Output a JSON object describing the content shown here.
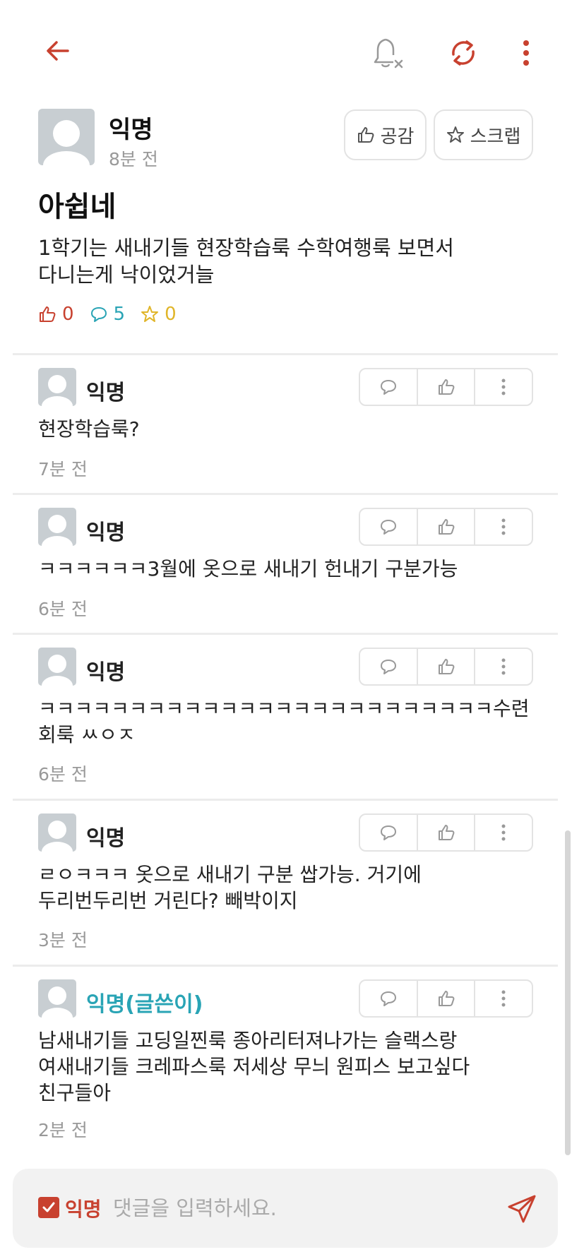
{
  "icons": {
    "back": "back-arrow-icon",
    "notifications": "bell-off-icon",
    "refresh": "refresh-icon",
    "more": "more-vertical-icon"
  },
  "colors": {
    "accent": "#c8412f",
    "comment_count": "#29a4b5",
    "scrap_count": "#e0b529",
    "op_author": "#29a4b5",
    "muted": "#999999"
  },
  "post": {
    "author": "익명",
    "time": "8분 전",
    "like_button": "공감",
    "scrap_button": "스크랩",
    "title": "아쉽네",
    "body": "1학기는 새내기들 현장학습룩 수학여행룩 보면서\n다니는게 낙이었거늘",
    "stats": {
      "likes": "0",
      "comments": "5",
      "scraps": "0"
    }
  },
  "comments": [
    {
      "author": "익명",
      "text": "현장학습룩?",
      "time": "7분 전"
    },
    {
      "author": "익명",
      "text": "ㅋㅋㅋㅋㅋㅋ3월에 옷으로 새내기 헌내기 구분가능",
      "time": "6분 전"
    },
    {
      "author": "익명",
      "text": "ㅋㅋㅋㅋㅋㅋㅋㅋㅋㅋㅋㅋㅋㅋㅋㅋㅋㅋㅋㅋㅋㅋㅋㅋㅋ수련\n회룩 ㅆㅇㅈ",
      "time": "6분 전"
    },
    {
      "author": "익명",
      "text": "ㄹㅇㅋㅋㅋ 옷으로 새내기 구분 쌉가능. 거기에\n두리번두리번 거린다? 빼박이지",
      "time": "3분 전"
    },
    {
      "author": "익명(글쓴이)",
      "text": "남새내기들 고딩일찐룩 종아리터져나가는 슬랙스랑\n여새내기들 크레파스룩 저세상 무늬 원피스 보고싶다\n친구들아",
      "time": "2분 전"
    }
  ],
  "composer": {
    "anonymous_label": "익명",
    "anonymous_checked": true,
    "placeholder": "댓글을 입력하세요."
  }
}
